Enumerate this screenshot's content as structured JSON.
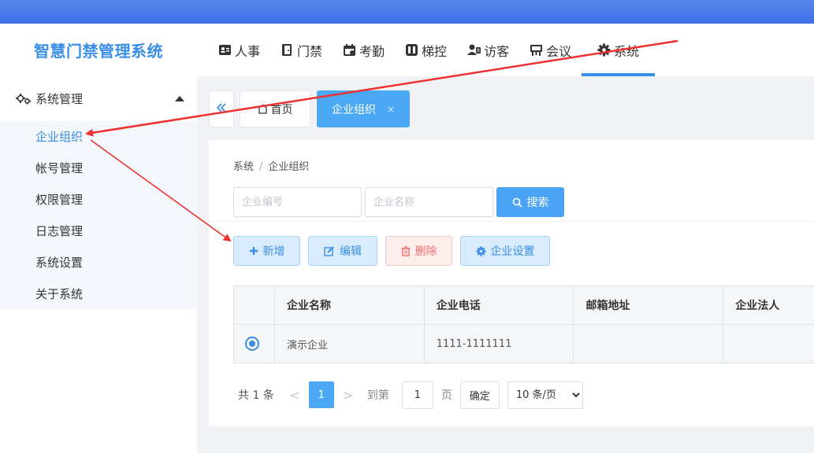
{
  "app": {
    "title": "智慧门禁管理系统"
  },
  "topnav": {
    "items": [
      {
        "label": "人事",
        "icon": "id-card-icon"
      },
      {
        "label": "门禁",
        "icon": "door-icon"
      },
      {
        "label": "考勤",
        "icon": "calendar-icon"
      },
      {
        "label": "梯控",
        "icon": "elevator-icon"
      },
      {
        "label": "访客",
        "icon": "visitor-card-icon"
      },
      {
        "label": "会议",
        "icon": "meeting-board-icon"
      },
      {
        "label": "系统",
        "icon": "gear-icon",
        "active": true
      }
    ]
  },
  "sidebar": {
    "group_label": "系统管理",
    "items": [
      {
        "label": "企业组织",
        "active": true
      },
      {
        "label": "帐号管理"
      },
      {
        "label": "权限管理"
      },
      {
        "label": "日志管理"
      },
      {
        "label": "系统设置"
      },
      {
        "label": "关于系统"
      }
    ]
  },
  "tabs": {
    "home_label": "首页",
    "active_label": "企业组织",
    "close_symbol": "×"
  },
  "breadcrumb": {
    "parent": "系统",
    "separator": "/",
    "current": "企业组织"
  },
  "search": {
    "code_placeholder": "企业编号",
    "name_placeholder": "企业名称",
    "button_label": "搜索"
  },
  "toolbar": {
    "add_label": "新增",
    "edit_label": "编辑",
    "delete_label": "删除",
    "settings_label": "企业设置"
  },
  "table": {
    "headers": [
      "企业名称",
      "企业电话",
      "邮箱地址",
      "企业法人"
    ],
    "rows": [
      {
        "selected": true,
        "name": "演示企业",
        "phone": "1111-1111111",
        "email": "",
        "legal": ""
      }
    ]
  },
  "pagination": {
    "total_label": "共 1 条",
    "prev_symbol": "<",
    "next_symbol": ">",
    "current_page": "1",
    "goto_label": "到第",
    "goto_value": "1",
    "page_unit": "页",
    "confirm_label": "确定",
    "page_size": "10 条/页"
  },
  "colors": {
    "accent": "#3a8ee6",
    "header_gradient": "#4a7deb",
    "annotation_arrow": "#f03030"
  }
}
